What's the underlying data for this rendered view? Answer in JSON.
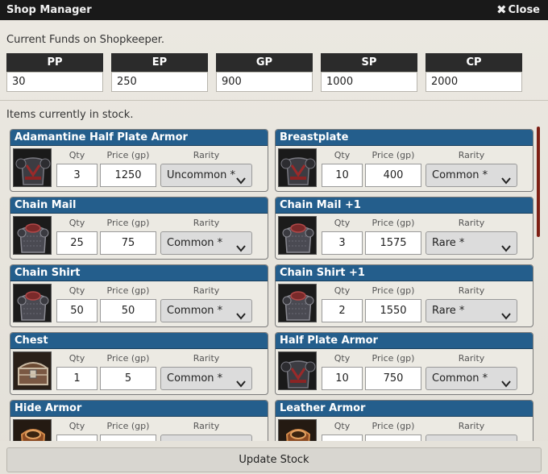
{
  "window": {
    "title": "Shop Manager",
    "close_label": "Close",
    "close_icon": "close-x-icon"
  },
  "funds": {
    "label": "Current Funds on Shopkeeper.",
    "currencies": [
      {
        "code": "PP",
        "value": "30"
      },
      {
        "code": "EP",
        "value": "250"
      },
      {
        "code": "GP",
        "value": "900"
      },
      {
        "code": "SP",
        "value": "1000"
      },
      {
        "code": "CP",
        "value": "2000"
      }
    ]
  },
  "stock": {
    "label": "Items currently in stock.",
    "columns": {
      "qty": "Qty",
      "price": "Price (gp)",
      "rarity": "Rarity"
    },
    "items": [
      {
        "name": "Adamantine Half Plate Armor",
        "qty": "3",
        "price": "1250",
        "rarity": "Uncommon *",
        "icon": "armor-icon"
      },
      {
        "name": "Breastplate",
        "qty": "10",
        "price": "400",
        "rarity": "Common *",
        "icon": "armor-icon"
      },
      {
        "name": "Chain Mail",
        "qty": "25",
        "price": "75",
        "rarity": "Common *",
        "icon": "chain-armor-icon"
      },
      {
        "name": "Chain Mail +1",
        "qty": "3",
        "price": "1575",
        "rarity": "Rare *",
        "icon": "chain-armor-icon"
      },
      {
        "name": "Chain Shirt",
        "qty": "50",
        "price": "50",
        "rarity": "Common *",
        "icon": "chain-armor-icon"
      },
      {
        "name": "Chain Shirt +1",
        "qty": "2",
        "price": "1550",
        "rarity": "Rare *",
        "icon": "chain-armor-icon"
      },
      {
        "name": "Chest",
        "qty": "1",
        "price": "5",
        "rarity": "Common *",
        "icon": "chest-icon"
      },
      {
        "name": "Half Plate Armor",
        "qty": "10",
        "price": "750",
        "rarity": "Common *",
        "icon": "armor-icon"
      },
      {
        "name": "Hide Armor",
        "qty": "",
        "price": "",
        "rarity": "",
        "icon": "hide-armor-icon"
      },
      {
        "name": "Leather Armor",
        "qty": "",
        "price": "",
        "rarity": "",
        "icon": "hide-armor-icon"
      }
    ]
  },
  "footer": {
    "update_label": "Update Stock"
  },
  "colors": {
    "titlebar": "#191919",
    "card_header": "#245e8c",
    "fund_header": "#2b2b2b",
    "scroll_thumb": "#7d1f14"
  }
}
